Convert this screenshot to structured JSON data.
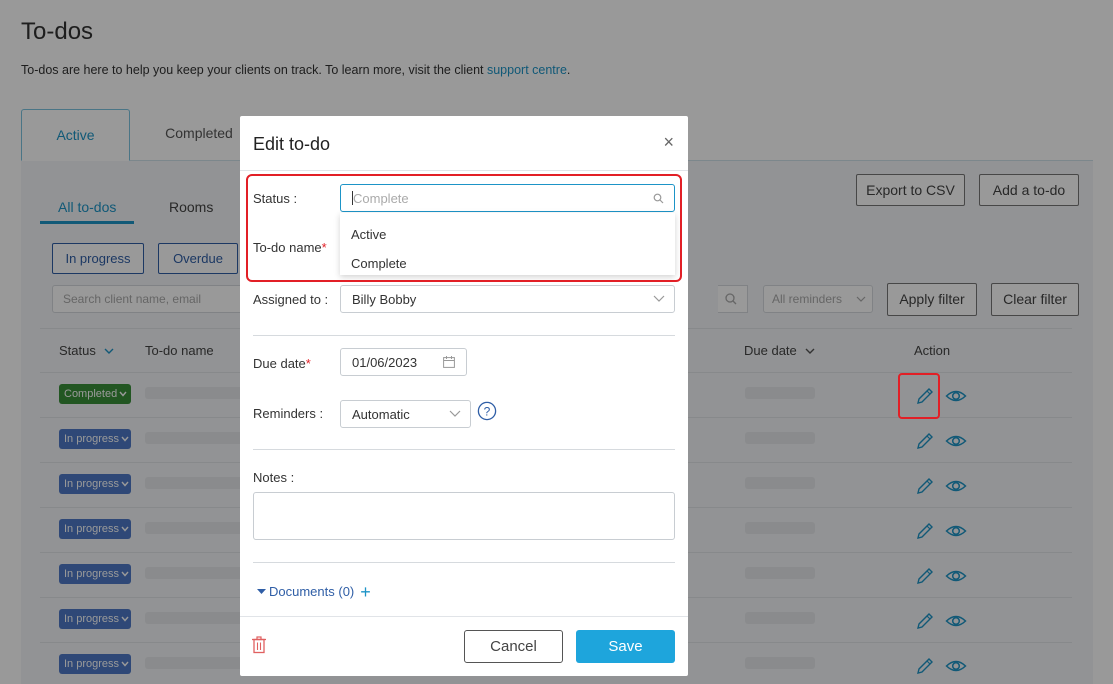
{
  "page": {
    "title": "To-dos",
    "intro_text": "To-dos are here to help you keep your clients on track. To learn more, visit the client ",
    "intro_link": "support centre",
    "intro_end": "."
  },
  "main_tabs": {
    "active": "Active",
    "completed": "Completed"
  },
  "sub_tabs": {
    "all": "All to-dos",
    "rooms": "Rooms"
  },
  "toolbar": {
    "export_label": "Export to CSV",
    "add_label": "Add a to-do"
  },
  "filters": {
    "in_progress": "In progress",
    "overdue": "Overdue",
    "search_placeholder": "Search client name, email",
    "reminders_placeholder": "All reminders",
    "apply_label": "Apply filter",
    "clear_label": "Clear filter"
  },
  "table": {
    "col_status": "Status",
    "col_name": "To-do name",
    "col_due": "Due date",
    "col_action": "Action",
    "rows": [
      {
        "status": "Completed"
      },
      {
        "status": "In progress"
      },
      {
        "status": "In progress"
      },
      {
        "status": "In progress"
      },
      {
        "status": "In progress"
      },
      {
        "status": "In progress"
      },
      {
        "status": "In progress"
      }
    ]
  },
  "modal": {
    "title": "Edit to-do",
    "close": "×",
    "status_label": "Status",
    "status_placeholder": "Complete",
    "status_options": [
      "Active",
      "Complete"
    ],
    "todo_name_label": "To-do name",
    "required_mark": "*",
    "assigned_label": "Assigned to",
    "assigned_value": "Billy Bobby",
    "due_label": "Due date",
    "due_value": "01/06/2023",
    "reminders_label": "Reminders",
    "reminders_value": "Automatic",
    "notes_label": "Notes",
    "notes_value": "",
    "documents_label": "Documents (0)",
    "cancel_label": "Cancel",
    "save_label": "Save"
  },
  "colors": {
    "accent": "#1d94c7",
    "save_button": "#1ea5dc",
    "completed_badge": "#3a8f3a",
    "in_progress_badge": "#4f79c6",
    "highlight": "#e21f26"
  }
}
